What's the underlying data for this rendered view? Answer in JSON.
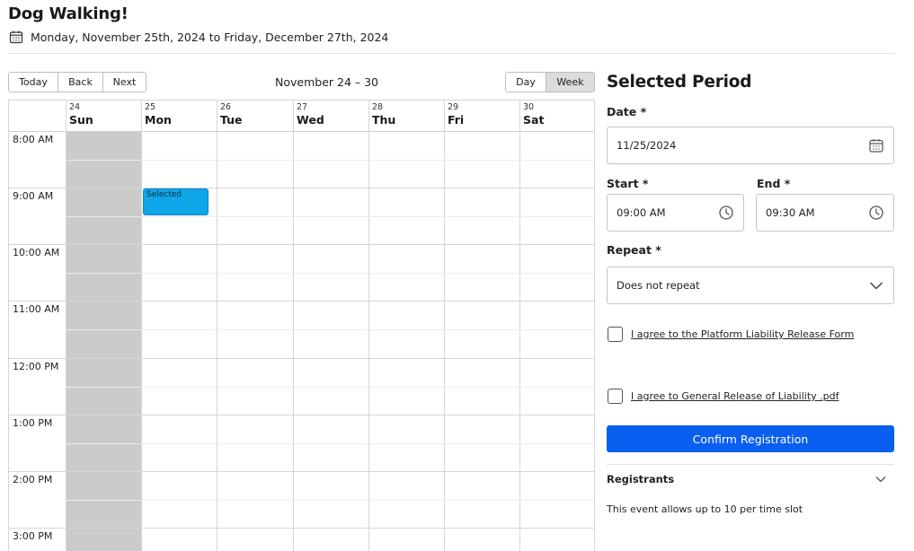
{
  "event": {
    "title": "Dog Walking!",
    "date_range": "Monday, November 25th, 2024 to Friday, December 27th, 2024"
  },
  "toolbar": {
    "nav": [
      "Today",
      "Back",
      "Next"
    ],
    "range_label": "November 24 – 30",
    "views": [
      "Day",
      "Week"
    ],
    "active_view": "Week"
  },
  "calendar": {
    "days": [
      {
        "num": "24",
        "name": "Sun"
      },
      {
        "num": "25",
        "name": "Mon"
      },
      {
        "num": "26",
        "name": "Tue"
      },
      {
        "num": "27",
        "name": "Wed"
      },
      {
        "num": "28",
        "name": "Thu"
      },
      {
        "num": "29",
        "name": "Fri"
      },
      {
        "num": "30",
        "name": "Sat"
      }
    ],
    "times": [
      "8:00 AM",
      "9:00 AM",
      "10:00 AM",
      "11:00 AM",
      "12:00 PM",
      "1:00 PM",
      "2:00 PM",
      "3:00 PM"
    ],
    "event_label": "Selected"
  },
  "form": {
    "section_title": "Selected Period",
    "date_label": "Date *",
    "date_value": "11/25/2024",
    "start_label": "Start *",
    "start_value": "09:00 AM",
    "end_label": "End *",
    "end_value": "09:30 AM",
    "repeat_label": "Repeat *",
    "repeat_value": "Does not repeat",
    "agree1": "I agree to the Platform Liability Release Form",
    "agree2": "I agree to General Release of Liability .pdf",
    "confirm": "Confirm Registration",
    "registrants_title": "Registrants",
    "registrants_text": "This event allows up to 10 per time slot"
  },
  "colors": {
    "accent": "#0a5ef0",
    "selected_event": "#0ea5e9",
    "unavailable_day": "#cbcbcb"
  }
}
